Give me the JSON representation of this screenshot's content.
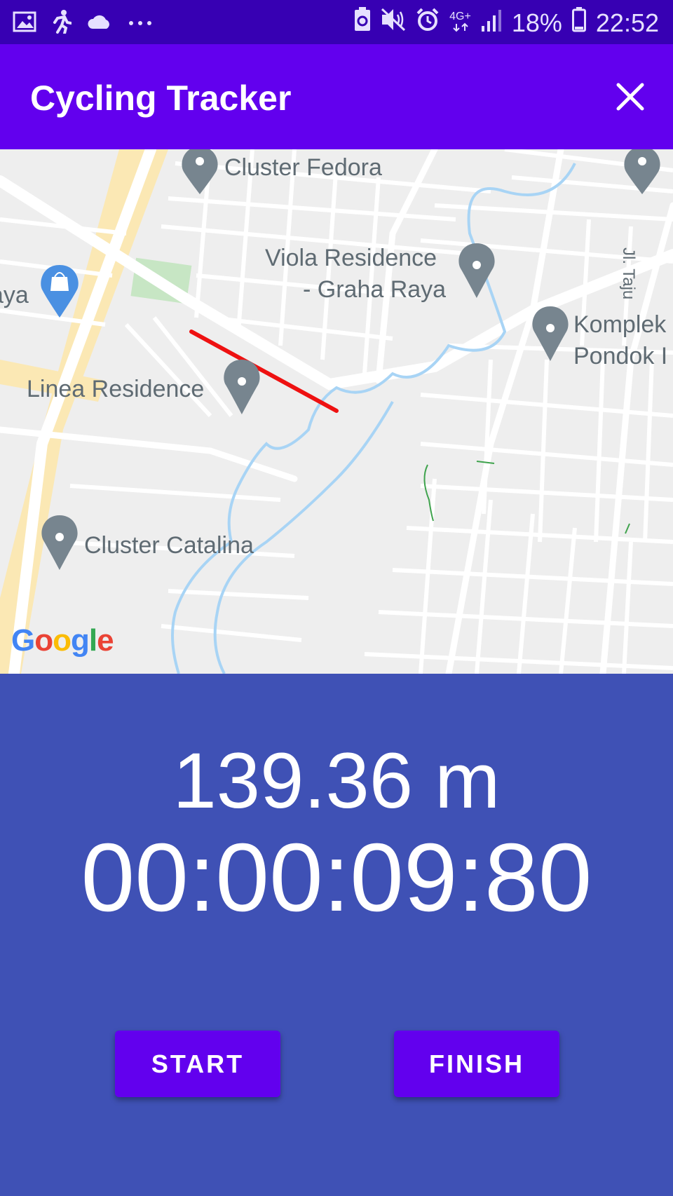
{
  "status_bar": {
    "network": "4G+",
    "battery": "18%",
    "time": "22:52",
    "icons_left": [
      "image-icon",
      "running-icon",
      "cloud-icon",
      "more-icon"
    ],
    "icons_right": [
      "battery-saver-icon",
      "mute-icon",
      "alarm-icon",
      "network-icon",
      "signal-icon",
      "battery-icon"
    ]
  },
  "app_bar": {
    "title": "Cycling Tracker",
    "close_icon": "close-icon"
  },
  "map": {
    "pois": [
      {
        "label": "Cluster Fedora"
      },
      {
        "label": "Viola Residence"
      },
      {
        "label": "- Graha Raya"
      },
      {
        "label": "Komplek"
      },
      {
        "label": "Pondok I"
      },
      {
        "label": "Linea Residence"
      },
      {
        "label": "Cluster Catalina"
      },
      {
        "label": "aya"
      },
      {
        "label": "Jl. Taju"
      }
    ],
    "attribution": "Google",
    "route_color": "#ee1111"
  },
  "tracker": {
    "distance": "139.36 m",
    "elapsed": "00:00:09:80"
  },
  "buttons": {
    "start": "START",
    "finish": "FINISH"
  },
  "colors": {
    "status_bar": "#3700b3",
    "app_bar": "#6200ee",
    "background": "#3f51b5",
    "button": "#6200ee"
  }
}
